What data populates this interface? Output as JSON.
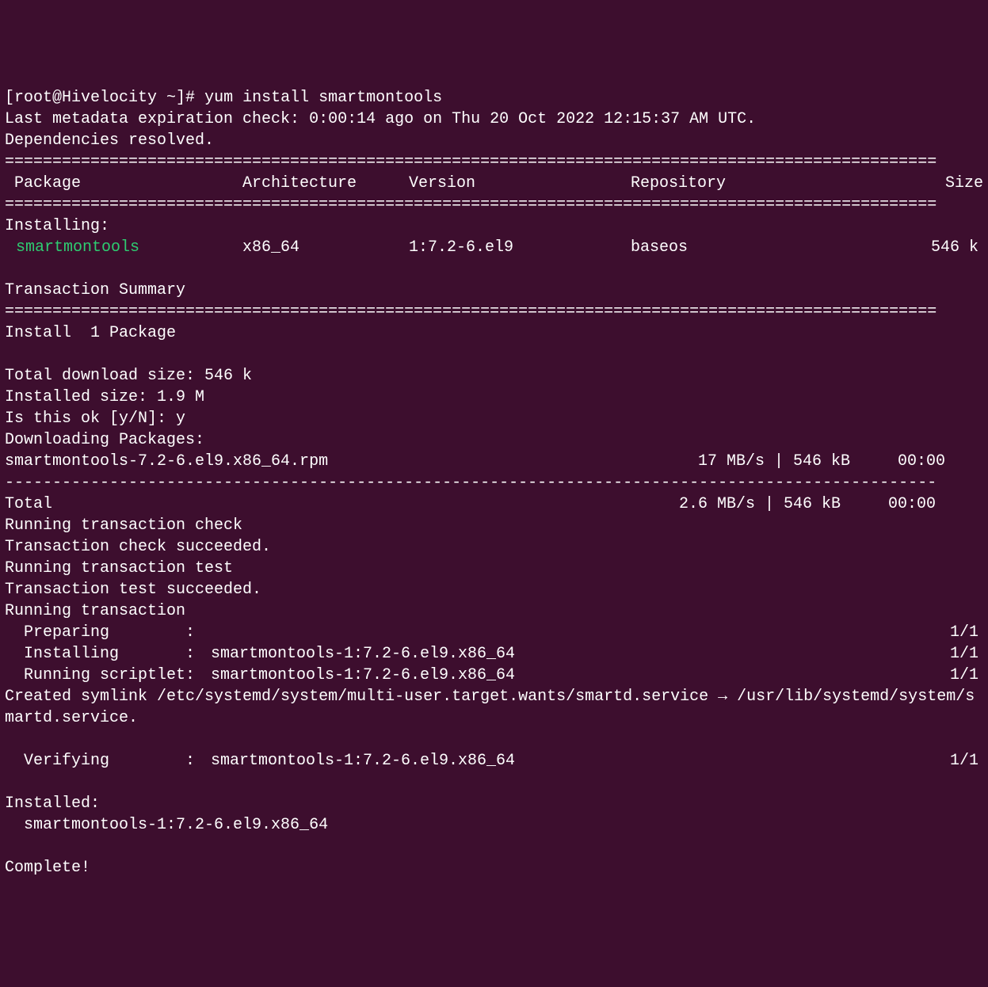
{
  "prompt": {
    "user_host": "[root@Hivelocity ~]#",
    "command": "yum install smartmontools"
  },
  "metadata_check": "Last metadata expiration check: 0:00:14 ago on Thu 20 Oct 2022 12:15:37 AM UTC.",
  "deps_resolved": "Dependencies resolved.",
  "divider_eq": "==================================================================================================",
  "divider_dash": "--------------------------------------------------------------------------------------------------",
  "headers": {
    "package": " Package",
    "arch": "Architecture",
    "version": "Version",
    "repo": "Repository",
    "size": "Size"
  },
  "installing_label": "Installing:",
  "install_row": {
    "package": "smartmontools",
    "arch": "x86_64",
    "version": "1:7.2-6.el9",
    "repo": "baseos",
    "size": "546 k"
  },
  "txn_summary": "Transaction Summary",
  "install_count": "Install  1 Package",
  "download_size": "Total download size: 546 k",
  "installed_size": "Installed size: 1.9 M",
  "confirm_prompt": "Is this ok [y/N]: y",
  "downloading_label": "Downloading Packages:",
  "download": {
    "file": "smartmontools-7.2-6.el9.x86_64.rpm",
    "stats": " 17 MB/s | 546 kB     00:00    "
  },
  "total": {
    "label": "Total",
    "stats": "2.6 MB/s | 546 kB     00:00     "
  },
  "txn_check": "Running transaction check",
  "txn_check_ok": "Transaction check succeeded.",
  "txn_test": "Running transaction test",
  "txn_test_ok": "Transaction test succeeded.",
  "txn_running": "Running transaction",
  "steps": {
    "preparing": {
      "label": "Preparing        :",
      "pkg": "",
      "count": "1/1"
    },
    "installing": {
      "label": "Installing       :",
      "pkg": "smartmontools-1:7.2-6.el9.x86_64",
      "count": "1/1"
    },
    "scriptlet": {
      "label": "Running scriptlet:",
      "pkg": "smartmontools-1:7.2-6.el9.x86_64",
      "count": "1/1"
    },
    "verifying": {
      "label": "Verifying        :",
      "pkg": "smartmontools-1:7.2-6.el9.x86_64",
      "count": "1/1"
    }
  },
  "symlink": "Created symlink /etc/systemd/system/multi-user.target.wants/smartd.service → /usr/lib/systemd/system/smartd.service.",
  "installed_label": "Installed:",
  "installed_pkg": "  smartmontools-1:7.2-6.el9.x86_64",
  "complete": "Complete!"
}
